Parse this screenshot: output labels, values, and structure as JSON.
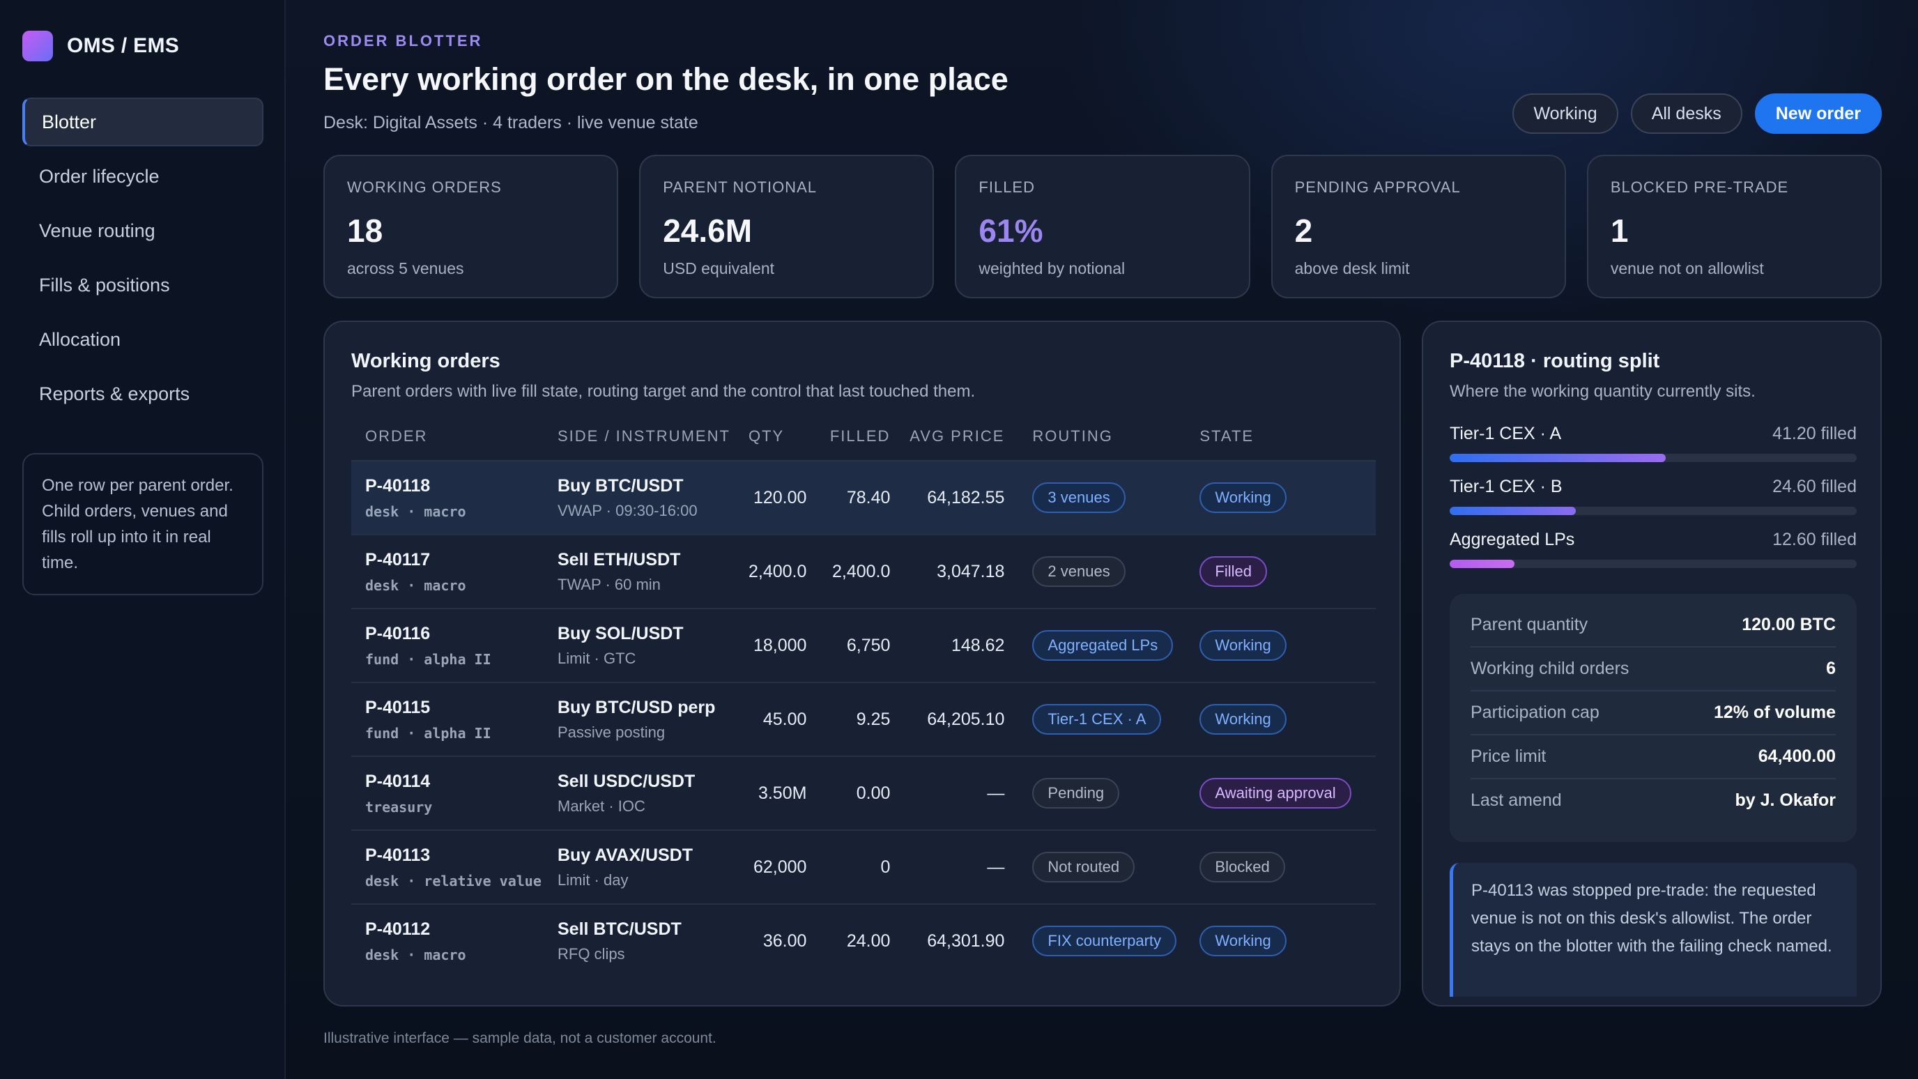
{
  "brand": {
    "name": "OMS / EMS"
  },
  "sidebar": {
    "items": [
      {
        "label": "Blotter"
      },
      {
        "label": "Order lifecycle"
      },
      {
        "label": "Venue routing"
      },
      {
        "label": "Fills & positions"
      },
      {
        "label": "Allocation"
      },
      {
        "label": "Reports & exports"
      }
    ],
    "note": "One row per parent order. Child orders, venues and fills roll up into it in real time."
  },
  "header": {
    "eyebrow": "ORDER BLOTTER",
    "title": "Every working order on the desk, in one place",
    "subtitle": "Desk: Digital Assets · 4 traders · live venue state",
    "buttons": {
      "working": "Working",
      "all_desks": "All desks",
      "new_order": "New order"
    }
  },
  "kpis": [
    {
      "label": "WORKING ORDERS",
      "value": "18",
      "note": "across 5 venues"
    },
    {
      "label": "PARENT NOTIONAL",
      "value": "24.6M",
      "note": "USD equivalent"
    },
    {
      "label": "FILLED",
      "value": "61%",
      "note": "weighted by notional"
    },
    {
      "label": "PENDING APPROVAL",
      "value": "2",
      "note": "above desk limit"
    },
    {
      "label": "BLOCKED PRE-TRADE",
      "value": "1",
      "note": "venue not on allowlist"
    }
  ],
  "orders_panel": {
    "title": "Working orders",
    "subtitle": "Parent orders with live fill state, routing target and the control that last touched them.",
    "columns": [
      "ORDER",
      "SIDE / INSTRUMENT",
      "QTY",
      "FILLED",
      "AVG PRICE",
      "ROUTING",
      "STATE"
    ],
    "rows": [
      {
        "id": "P-40118",
        "desk": "desk · macro",
        "instrument": "Buy BTC/USDT",
        "algo": "VWAP · 09:30-16:00",
        "qty": "120.00",
        "filled": "78.40",
        "avg": "64,182.55",
        "routing": "3 venues",
        "state": "Working"
      },
      {
        "id": "P-40117",
        "desk": "desk · macro",
        "instrument": "Sell ETH/USDT",
        "algo": "TWAP · 60 min",
        "qty": "2,400.0",
        "filled": "2,400.0",
        "avg": "3,047.18",
        "routing": "2 venues",
        "state": "Filled"
      },
      {
        "id": "P-40116",
        "desk": "fund · alpha II",
        "instrument": "Buy SOL/USDT",
        "algo": "Limit · GTC",
        "qty": "18,000",
        "filled": "6,750",
        "avg": "148.62",
        "routing": "Aggregated LPs",
        "state": "Working"
      },
      {
        "id": "P-40115",
        "desk": "fund · alpha II",
        "instrument": "Buy BTC/USD perp",
        "algo": "Passive posting",
        "qty": "45.00",
        "filled": "9.25",
        "avg": "64,205.10",
        "routing": "Tier-1 CEX · A",
        "state": "Working"
      },
      {
        "id": "P-40114",
        "desk": "treasury",
        "instrument": "Sell USDC/USDT",
        "algo": "Market · IOC",
        "qty": "3.50M",
        "filled": "0.00",
        "avg": "—",
        "routing": "Pending",
        "state": "Awaiting approval"
      },
      {
        "id": "P-40113",
        "desk": "desk · relative value",
        "instrument": "Buy AVAX/USDT",
        "algo": "Limit · day",
        "qty": "62,000",
        "filled": "0",
        "avg": "—",
        "routing": "Not routed",
        "state": "Blocked"
      },
      {
        "id": "P-40112",
        "desk": "desk · macro",
        "instrument": "Sell BTC/USDT",
        "algo": "RFQ clips",
        "qty": "36.00",
        "filled": "24.00",
        "avg": "64,301.90",
        "routing": "FIX counterparty",
        "state": "Working"
      }
    ]
  },
  "routing_panel": {
    "title": "P-40118 · routing split",
    "subtitle": "Where the working quantity currently sits.",
    "venues": [
      {
        "name": "Tier-1 CEX · A",
        "value": "41.20 filled",
        "fraction": 0.53
      },
      {
        "name": "Tier-1 CEX · B",
        "value": "24.60 filled",
        "fraction": 0.31
      },
      {
        "name": "Aggregated LPs",
        "value": "12.60 filled",
        "fraction": 0.16
      }
    ],
    "stats": [
      {
        "label": "Parent quantity",
        "value": "120.00 BTC"
      },
      {
        "label": "Working child orders",
        "value": "6"
      },
      {
        "label": "Participation cap",
        "value": "12% of volume"
      },
      {
        "label": "Price limit",
        "value": "64,400.00"
      },
      {
        "label": "Last amend",
        "value": "by J. Okafor"
      }
    ],
    "callout": "P-40113 was stopped pre-trade: the requested venue is not on this desk's allowlist. The order stays on the blotter with the failing check named."
  },
  "footer": "Illustrative interface — sample data, not a customer account.",
  "colors": {
    "accent": "#1f74f0",
    "purple": "#9b86f2",
    "bg": "#0b1220"
  }
}
